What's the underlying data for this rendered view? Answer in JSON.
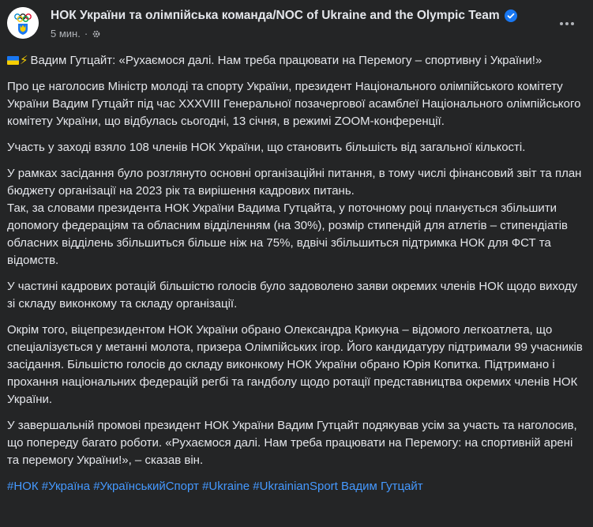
{
  "header": {
    "page_name": "НОК України та олімпійська команда/NOC of Ukraine and the Olympic Team",
    "time": "5 мин.",
    "separator": "·"
  },
  "icons": {
    "avatar": "noc-ukraine-logo-icon",
    "verified": "verified-badge-icon",
    "privacy": "gear-icon",
    "more": "more-options-icon",
    "flag": "ukraine-flag-icon",
    "bolt": "lightning-icon"
  },
  "colors": {
    "background": "#242526",
    "text": "#e4e6eb",
    "secondary_text": "#b0b3b8",
    "link": "#4599ff",
    "verified": "#1877f2"
  },
  "post": {
    "title_prefix": "⚡",
    "title": "Вадим Гутцайт: «Рухаємося далі. Нам треба працювати на Перемогу – спортивну і України!»",
    "paragraphs": [
      "Про це наголосив Міністр молоді та спорту України, президент Національного олімпійського комітету України Вадим Гутцайт під час XXXVIII Генеральної позачергової асамблеї Національного олімпійського комітету України, що відбулась сьогодні, 13 січня, в режимі ZOOM-конференції.",
      "Участь у заході взяло 108 членів НОК України, що становить більшість від загальної кількості.",
      "У рамках засідання було розглянуто основні організаційні питання, в тому числі фінансовий звіт та план бюджету організації на 2023 рік та вирішення кадрових питань.",
      "Так, за словами президента НОК України Вадима Гутцайта, у поточному році планується збільшити допомогу федераціям та обласним відділенням (на 30%), розмір стипендій для атлетів – стипендіатів обласних відділень збільшиться більше ніж на 75%, вдвічі збільшиться підтримка НОК для ФСТ та відомств.",
      "У частині кадрових ротацій більшістю голосів було задоволено заяви окремих членів НОК щодо виходу зі складу виконкому та складу організації.",
      "Окрім того, віцепрезидентом НОК України обрано Олександра Крикуна – відомого легкоатлета, що спеціалізується у метанні молота, призера Олімпійських ігор. Його кандидатуру підтримали 99 учасників засідання. Більшістю голосів до складу виконкому НОК України обрано Юрія Копитка. Підтримано і прохання національних федерацій регбі та гандболу щодо ротації представництва окремих членів НОК України.",
      "У завершальній промові президент НОК України Вадим Гутцайт подякував усім за участь та наголосив, що попереду багато роботи. «Рухаємося далі. Нам треба працювати на Перемогу: на спортивній арені та перемогу України!», – сказав він."
    ],
    "hashtags": [
      "#НОК",
      "#Україна",
      "#УкраїнськийСпорт",
      "#Ukraine",
      "#UkrainianSport",
      "Вадим Гутцайт"
    ]
  }
}
